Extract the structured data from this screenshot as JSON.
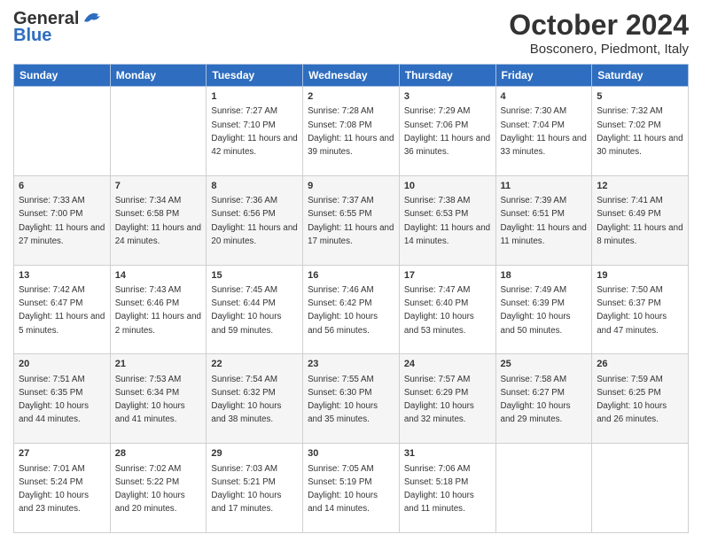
{
  "header": {
    "logo_general": "General",
    "logo_blue": "Blue",
    "month_title": "October 2024",
    "location": "Bosconero, Piedmont, Italy"
  },
  "weekdays": [
    "Sunday",
    "Monday",
    "Tuesday",
    "Wednesday",
    "Thursday",
    "Friday",
    "Saturday"
  ],
  "weeks": [
    [
      null,
      null,
      {
        "day": 1,
        "sunrise": "7:27 AM",
        "sunset": "7:10 PM",
        "daylight": "11 hours and 42 minutes."
      },
      {
        "day": 2,
        "sunrise": "7:28 AM",
        "sunset": "7:08 PM",
        "daylight": "11 hours and 39 minutes."
      },
      {
        "day": 3,
        "sunrise": "7:29 AM",
        "sunset": "7:06 PM",
        "daylight": "11 hours and 36 minutes."
      },
      {
        "day": 4,
        "sunrise": "7:30 AM",
        "sunset": "7:04 PM",
        "daylight": "11 hours and 33 minutes."
      },
      {
        "day": 5,
        "sunrise": "7:32 AM",
        "sunset": "7:02 PM",
        "daylight": "11 hours and 30 minutes."
      }
    ],
    [
      {
        "day": 6,
        "sunrise": "7:33 AM",
        "sunset": "7:00 PM",
        "daylight": "11 hours and 27 minutes."
      },
      {
        "day": 7,
        "sunrise": "7:34 AM",
        "sunset": "6:58 PM",
        "daylight": "11 hours and 24 minutes."
      },
      {
        "day": 8,
        "sunrise": "7:36 AM",
        "sunset": "6:56 PM",
        "daylight": "11 hours and 20 minutes."
      },
      {
        "day": 9,
        "sunrise": "7:37 AM",
        "sunset": "6:55 PM",
        "daylight": "11 hours and 17 minutes."
      },
      {
        "day": 10,
        "sunrise": "7:38 AM",
        "sunset": "6:53 PM",
        "daylight": "11 hours and 14 minutes."
      },
      {
        "day": 11,
        "sunrise": "7:39 AM",
        "sunset": "6:51 PM",
        "daylight": "11 hours and 11 minutes."
      },
      {
        "day": 12,
        "sunrise": "7:41 AM",
        "sunset": "6:49 PM",
        "daylight": "11 hours and 8 minutes."
      }
    ],
    [
      {
        "day": 13,
        "sunrise": "7:42 AM",
        "sunset": "6:47 PM",
        "daylight": "11 hours and 5 minutes."
      },
      {
        "day": 14,
        "sunrise": "7:43 AM",
        "sunset": "6:46 PM",
        "daylight": "11 hours and 2 minutes."
      },
      {
        "day": 15,
        "sunrise": "7:45 AM",
        "sunset": "6:44 PM",
        "daylight": "10 hours and 59 minutes."
      },
      {
        "day": 16,
        "sunrise": "7:46 AM",
        "sunset": "6:42 PM",
        "daylight": "10 hours and 56 minutes."
      },
      {
        "day": 17,
        "sunrise": "7:47 AM",
        "sunset": "6:40 PM",
        "daylight": "10 hours and 53 minutes."
      },
      {
        "day": 18,
        "sunrise": "7:49 AM",
        "sunset": "6:39 PM",
        "daylight": "10 hours and 50 minutes."
      },
      {
        "day": 19,
        "sunrise": "7:50 AM",
        "sunset": "6:37 PM",
        "daylight": "10 hours and 47 minutes."
      }
    ],
    [
      {
        "day": 20,
        "sunrise": "7:51 AM",
        "sunset": "6:35 PM",
        "daylight": "10 hours and 44 minutes."
      },
      {
        "day": 21,
        "sunrise": "7:53 AM",
        "sunset": "6:34 PM",
        "daylight": "10 hours and 41 minutes."
      },
      {
        "day": 22,
        "sunrise": "7:54 AM",
        "sunset": "6:32 PM",
        "daylight": "10 hours and 38 minutes."
      },
      {
        "day": 23,
        "sunrise": "7:55 AM",
        "sunset": "6:30 PM",
        "daylight": "10 hours and 35 minutes."
      },
      {
        "day": 24,
        "sunrise": "7:57 AM",
        "sunset": "6:29 PM",
        "daylight": "10 hours and 32 minutes."
      },
      {
        "day": 25,
        "sunrise": "7:58 AM",
        "sunset": "6:27 PM",
        "daylight": "10 hours and 29 minutes."
      },
      {
        "day": 26,
        "sunrise": "7:59 AM",
        "sunset": "6:25 PM",
        "daylight": "10 hours and 26 minutes."
      }
    ],
    [
      {
        "day": 27,
        "sunrise": "7:01 AM",
        "sunset": "5:24 PM",
        "daylight": "10 hours and 23 minutes."
      },
      {
        "day": 28,
        "sunrise": "7:02 AM",
        "sunset": "5:22 PM",
        "daylight": "10 hours and 20 minutes."
      },
      {
        "day": 29,
        "sunrise": "7:03 AM",
        "sunset": "5:21 PM",
        "daylight": "10 hours and 17 minutes."
      },
      {
        "day": 30,
        "sunrise": "7:05 AM",
        "sunset": "5:19 PM",
        "daylight": "10 hours and 14 minutes."
      },
      {
        "day": 31,
        "sunrise": "7:06 AM",
        "sunset": "5:18 PM",
        "daylight": "10 hours and 11 minutes."
      },
      null,
      null
    ]
  ]
}
